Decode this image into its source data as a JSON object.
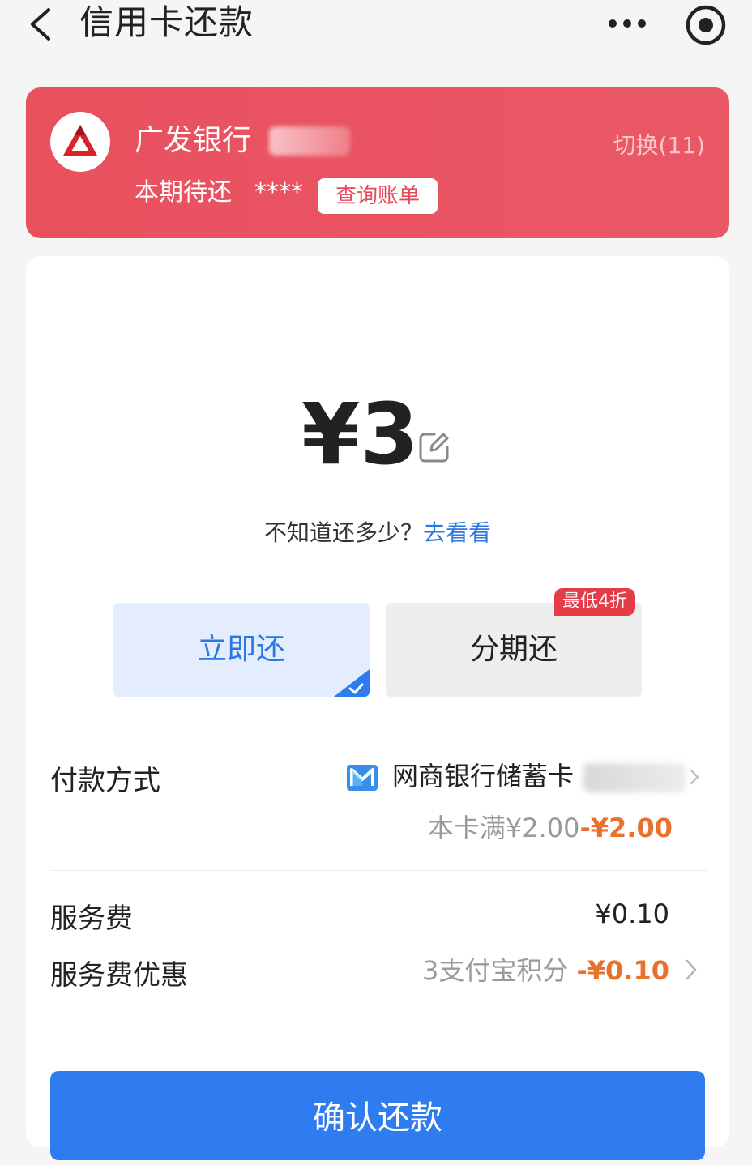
{
  "header": {
    "title": "信用卡还款",
    "back_icon": "chevron-left-icon",
    "more_icon": "more-dots-icon",
    "target_icon": "target-icon"
  },
  "bank_card": {
    "bank_name": "广发银行",
    "bank_suffix_masked": "79",
    "switch_label": "切换(11)",
    "due_label": "本期待还",
    "due_value": "****",
    "bill_button": "查询账单",
    "logo_icon": "bank-logo-icon",
    "bg_color": "#e9505e"
  },
  "amount": {
    "value": "¥3",
    "edit_icon": "edit-icon"
  },
  "hint": {
    "text": "不知道还多少？",
    "link": "去看看",
    "link_color": "#2d76e6"
  },
  "options": {
    "now": {
      "label": "立即还",
      "selected": true
    },
    "installment": {
      "label": "分期还",
      "badge": "最低4折"
    }
  },
  "payment": {
    "label": "付款方式",
    "method": "网商银行储蓄卡",
    "method_masked": "(0",
    "discount_prefix": "本卡满¥2.00",
    "discount_value": "-¥2.00",
    "method_icon": "mybank-icon"
  },
  "service_fee": {
    "label": "服务费",
    "value": "¥0.10"
  },
  "fee_discount": {
    "label": "服务费优惠",
    "desc": "3支付宝积分",
    "value": "-¥0.10"
  },
  "confirm_button": "确认还款",
  "colors": {
    "accent_blue": "#2f7bf0",
    "discount_orange": "#e8722b",
    "badge_red": "#e53d47"
  }
}
